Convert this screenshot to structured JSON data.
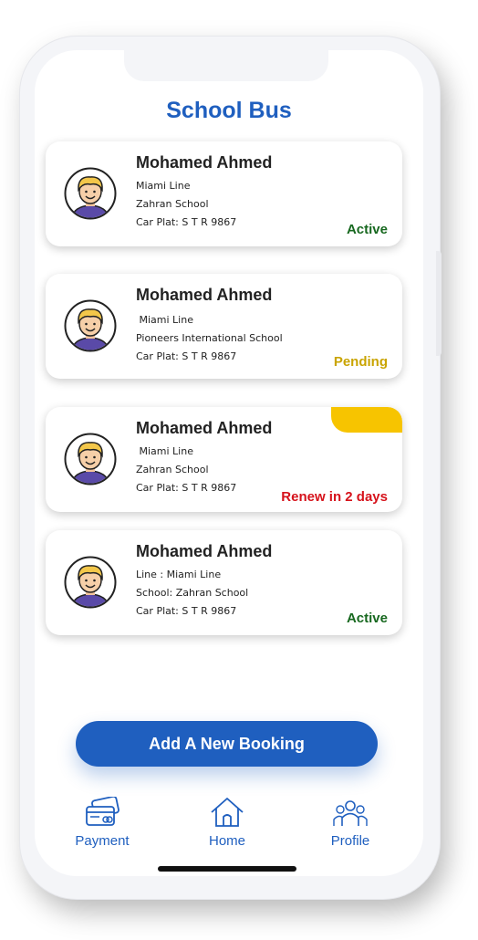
{
  "header": {
    "title": "School Bus"
  },
  "colors": {
    "active": "#17681f",
    "pending": "#c9a400",
    "renew": "#d6121b",
    "accent": "#1f5fbf",
    "flag": "#f7c400"
  },
  "cards": [
    {
      "name": "Mohamed Ahmed",
      "line1": "Miami Line",
      "line2": "Zahran School",
      "line3": "Car Plat: S T R 9867",
      "status": "Active"
    },
    {
      "name": "Mohamed Ahmed",
      "line1": " Miami Line",
      "line2": "Pioneers International School",
      "line3": "Car Plat: S T R 9867",
      "status": "Pending"
    },
    {
      "name": "Mohamed Ahmed",
      "line1": " Miami Line",
      "line2": "Zahran School",
      "line3": "Car Plat: S T R 9867",
      "status": "Renew in 2 days"
    },
    {
      "name": "Mohamed Ahmed",
      "line1": "Line : Miami Line",
      "line2": "School: Zahran School",
      "line3": "Car Plat: S T R 9867",
      "status": "Active"
    }
  ],
  "actions": {
    "add_booking": "Add A New Booking"
  },
  "nav": {
    "payment": "Payment",
    "home": "Home",
    "profile": "Profile"
  }
}
